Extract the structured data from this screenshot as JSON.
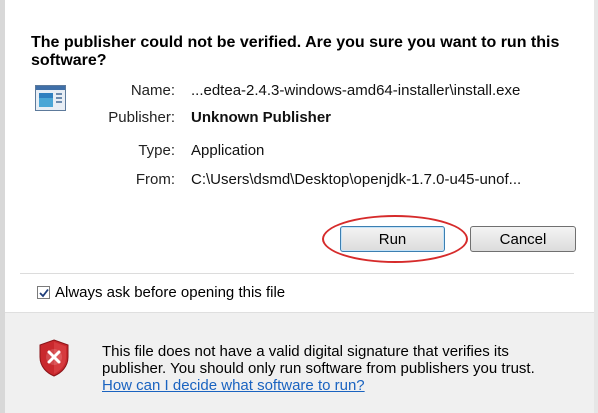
{
  "dialog": {
    "heading": "The publisher could not be verified.  Are you sure you want to run this software?",
    "details": {
      "name_label": "Name:",
      "name_value": "...edtea-2.4.3-windows-amd64-installer\\install.exe",
      "publisher_label": "Publisher:",
      "publisher_value": "Unknown Publisher",
      "type_label": "Type:",
      "type_value": "Application",
      "from_label": "From:",
      "from_value": "C:\\Users\\dsmd\\Desktop\\openjdk-1.7.0-u45-unof..."
    },
    "buttons": {
      "run": "Run",
      "cancel": "Cancel"
    },
    "checkbox": {
      "label": "Always ask before opening this file",
      "checked": true
    },
    "warning": {
      "text": "This file does not have a valid digital signature that verifies its publisher.  You should only run software from publishers you trust.",
      "link": "How can I decide what software to run?"
    }
  },
  "icons": {
    "app": "application-window-icon",
    "shield": "security-warning-shield-icon",
    "checkmark": "checkmark-icon"
  },
  "colors": {
    "highlight": "#d62b2b",
    "link": "#1a63c0",
    "shield_red": "#c9282d"
  }
}
